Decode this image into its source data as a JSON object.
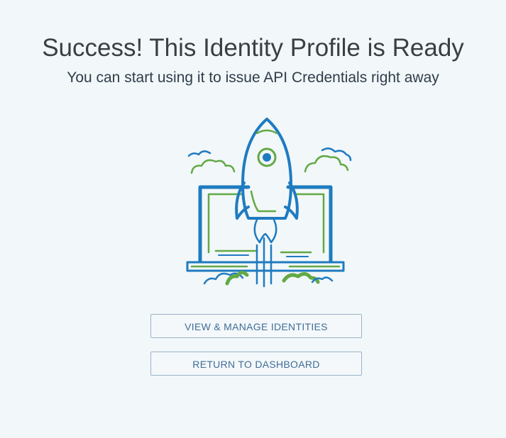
{
  "header": {
    "title": "Success! This Identity Profile is Ready",
    "subtitle": "You can start using it to issue API Credentials right away"
  },
  "illustration": {
    "icon": "rocket-launch-laptop-icon",
    "colors": {
      "blue": "#1f7bc0",
      "green": "#62a945"
    }
  },
  "actions": {
    "manage_label": "VIEW & MANAGE IDENTITIES",
    "dashboard_label": "RETURN TO DASHBOARD"
  },
  "theme": {
    "background": "#f2f7f9",
    "button_text": "#3f6d97",
    "button_border": "#9ab3cb"
  }
}
